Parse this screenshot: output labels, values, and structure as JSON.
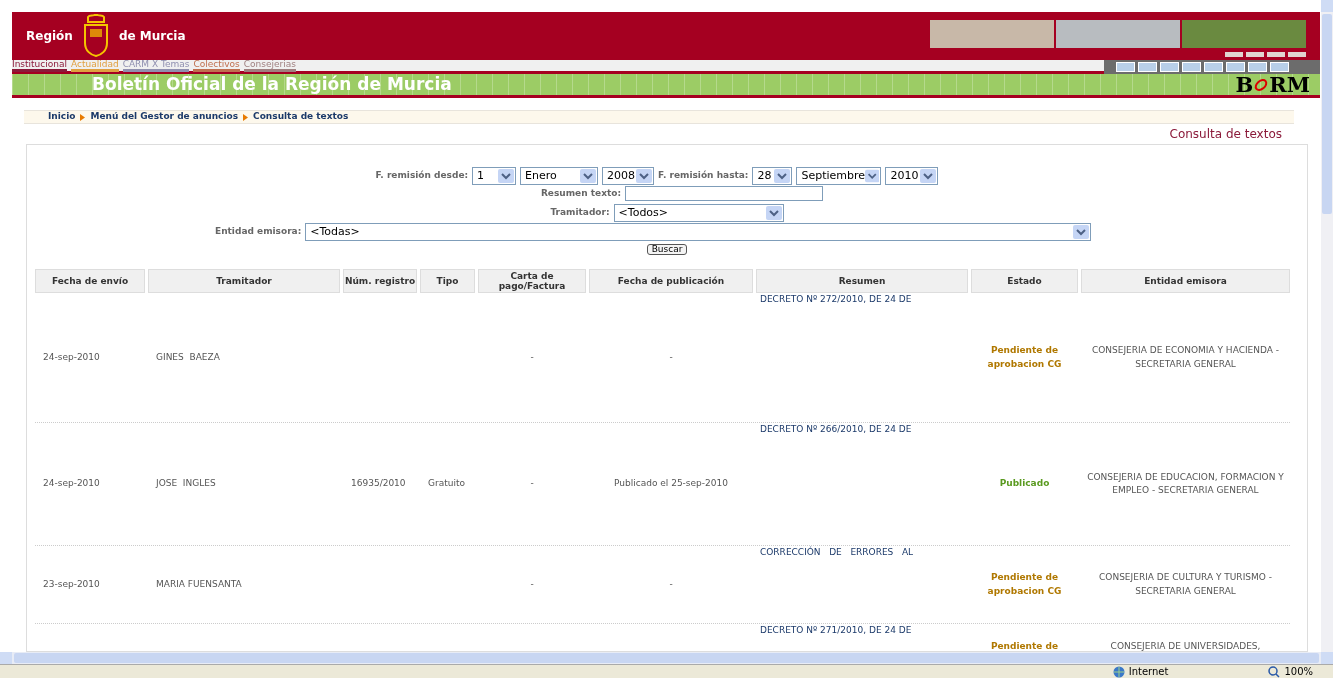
{
  "header": {
    "brand_left": "Región",
    "brand_right": "de Murcia",
    "nav": [
      {
        "label": "Institucional",
        "color": "#8b1a3a"
      },
      {
        "label": "Actualidad",
        "color": "#e0a040"
      },
      {
        "label": "CARM X Temas",
        "color": "#9090b0"
      },
      {
        "label": "Colectivos",
        "color": "#c07050"
      },
      {
        "label": "Consejerias",
        "color": "#a08080"
      }
    ],
    "banner_title": "Boletín Oficial de la Región de Murcia",
    "logo": "B",
    "logo_end": "RM"
  },
  "breadcrumb": [
    "Inicio",
    "Menú del Gestor de anuncios",
    "Consulta de textos"
  ],
  "panel_title": "Consulta de textos",
  "form": {
    "from_label": "F. remisión desde:",
    "from_day": "1",
    "from_month": "Enero",
    "from_year": "2008",
    "to_label": "F. remisión hasta:",
    "to_day": "28",
    "to_month": "Septiembre",
    "to_year": "2010",
    "summary_label": "Resumen texto:",
    "handler_label": "Tramitador:",
    "handler_value": "<Todos>",
    "entity_label": "Entidad emisora:",
    "entity_value": "<Todas>",
    "search_button": "Buscar"
  },
  "table": {
    "columns": [
      "Fecha de envío",
      "Tramitador",
      "Núm. registro",
      "Tipo",
      "Carta de pago/Factura",
      "Fecha de publicación",
      "Resumen",
      "Estado",
      "Entidad emisora"
    ],
    "rows": [
      {
        "date": "24-sep-2010",
        "handler": "GINES  BAEZA",
        "register": "",
        "type": "",
        "payment": "-",
        "publication": "-",
        "summary": "DECRETO Nº 272/2010, DE 24 DE",
        "status": "Pendiente de aprobacion CG",
        "kind": "pending",
        "entity": "CONSEJERIA DE ECONOMIA Y HACIENDA - SECRETARIA GENERAL"
      },
      {
        "date": "24-sep-2010",
        "handler": "JOSE  INGLES",
        "register": "16935/2010",
        "type": "Gratuito",
        "payment": "-",
        "publication": "Publicado el 25-sep-2010",
        "summary": "DECRETO Nº 266/2010, DE 24 DE",
        "status": "Publicado",
        "kind": "published",
        "entity": "CONSEJERIA DE EDUCACION, FORMACION Y EMPLEO - SECRETARIA GENERAL"
      },
      {
        "date": "23-sep-2010",
        "handler": "MARIA FUENSANTA",
        "register": "",
        "type": "",
        "payment": "-",
        "publication": "-",
        "summary": "CORRECCIÓN   DE   ERRORES   AL",
        "status": "Pendiente de aprobacion CG",
        "kind": "pending",
        "entity": "CONSEJERIA DE CULTURA Y TURISMO - SECRETARIA GENERAL"
      },
      {
        "date": "",
        "handler": "",
        "register": "",
        "type": "",
        "payment": "",
        "publication": "",
        "summary": "DECRETO Nº 271/2010, DE 24 DE",
        "status": "Pendiente de",
        "kind": "pending",
        "entity": "CONSEJERIA DE UNIVERSIDADES,"
      }
    ]
  },
  "status_bar": {
    "zone": "Internet",
    "zoom": "100%"
  }
}
